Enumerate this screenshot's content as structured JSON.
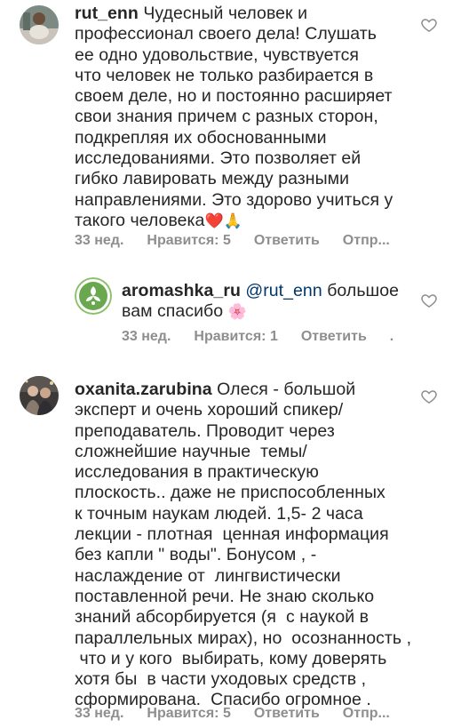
{
  "comments": [
    {
      "username": "rut_enn",
      "text": " Чудесный человек и\nпрофессионал своего дела! Слушать\nее одно удовольствие, чувствуется\nчто человек не только разбирается в\nсвоем деле, но и постоянно расширяет\nсвои знания причем с разных сторон,\nподкрепляя их обоснованными\nисследованиями. Это позволяет ей\nгибко лавировать между разными\nнаправлениями. Это здорово учиться у\nтакого человека",
      "emoji": "❤️🙏",
      "time": "33 нед.",
      "likes": "Нравится: 5",
      "reply": "Ответить",
      "send": "Отпр..."
    },
    {
      "username": "aromashka_ru",
      "mention": " @rut_enn",
      "text_line1": " большое",
      "text_line2": "вам спасибо ",
      "emoji": "🌸",
      "time": "33 нед.",
      "likes": "Нравится: 1",
      "reply": "Ответить",
      "more": "."
    },
    {
      "username": "oxanita.zarubina",
      "text": " Олеся - большой\nэксперт и очень хороший спикер/\nпреподаватель. Проводит через\nсложнейшие научные  темы/\nисследования в практическую\nплоскость.. даже не приспособленных\nк точным наукам людей. 1,5- 2 часа\nлекции - плотная  ценная информация\nбез капли \" воды\". Бонусом , -\nнаслаждение от  лингвистически\nпоставленной речи. Не знаю сколько\nзнаний абсорбируется (я  с наукой в\nпараллельных мирах), но  осознанность ,\n что и у кого  выбирать, кому доверять\nхотя бы  в части уходовых средств ,\nсформирована.  Спасибо огромное .",
      "time": "33 нед.",
      "likes": "Нравится: 5",
      "reply": "Ответить",
      "send": "Отпр..."
    }
  ],
  "colors": {
    "text": "#262626",
    "meta": "#8e8e8e",
    "mention": "#00376b",
    "aroma_green": "#6aa84f"
  }
}
